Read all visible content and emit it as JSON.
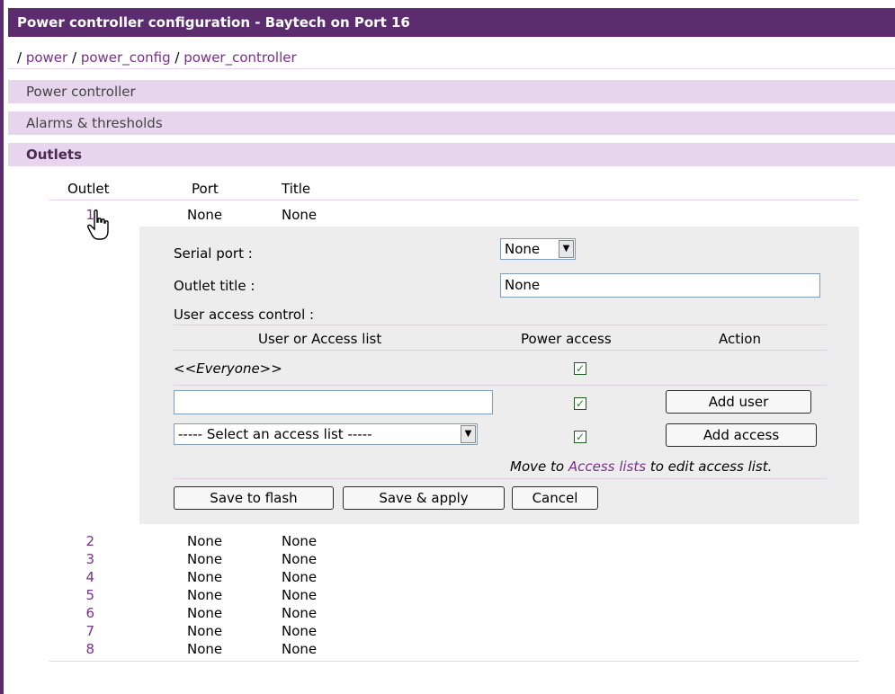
{
  "page": {
    "title": "Power controller configuration - Baytech on Port 16",
    "breadcrumb": [
      "power",
      "power_config",
      "power_controller"
    ],
    "breadcrumb_sep": "/"
  },
  "sections": {
    "power_controller": "Power controller",
    "alarms": "Alarms & thresholds",
    "outlets": "Outlets"
  },
  "table": {
    "headers": {
      "outlet": "Outlet",
      "port": "Port",
      "title": "Title"
    },
    "rows": [
      {
        "outlet": "1",
        "port": "None",
        "title": "None"
      },
      {
        "outlet": "2",
        "port": "None",
        "title": "None"
      },
      {
        "outlet": "3",
        "port": "None",
        "title": "None"
      },
      {
        "outlet": "4",
        "port": "None",
        "title": "None"
      },
      {
        "outlet": "5",
        "port": "None",
        "title": "None"
      },
      {
        "outlet": "6",
        "port": "None",
        "title": "None"
      },
      {
        "outlet": "7",
        "port": "None",
        "title": "None"
      },
      {
        "outlet": "8",
        "port": "None",
        "title": "None"
      }
    ]
  },
  "edit": {
    "serial_port_label": "Serial port :",
    "serial_port_value": "None",
    "outlet_title_label": "Outlet title :",
    "outlet_title_value": "None",
    "uac_label": "User access control :",
    "uac_headers": {
      "user": "User or Access list",
      "power": "Power access",
      "action": "Action"
    },
    "everyone": "<<Everyone>>",
    "user_input_value": "",
    "access_list_select": "----- Select an access list -----",
    "add_user": "Add user",
    "add_access": "Add access",
    "note_prefix": "Move to",
    "note_link": "Access lists",
    "note_suffix": "to edit access list.",
    "save_flash": "Save to flash",
    "save_apply": "Save & apply",
    "cancel": "Cancel"
  },
  "colors": {
    "accent": "#5c2d6e",
    "section_bg": "#e6d5ec",
    "link": "#7a2f8c",
    "checkmark": "#1f8a1f"
  },
  "icons": {
    "checkbox": "checkmark-icon",
    "dropdown": "chevron-down-icon",
    "cursor": "hand-pointer-icon"
  }
}
